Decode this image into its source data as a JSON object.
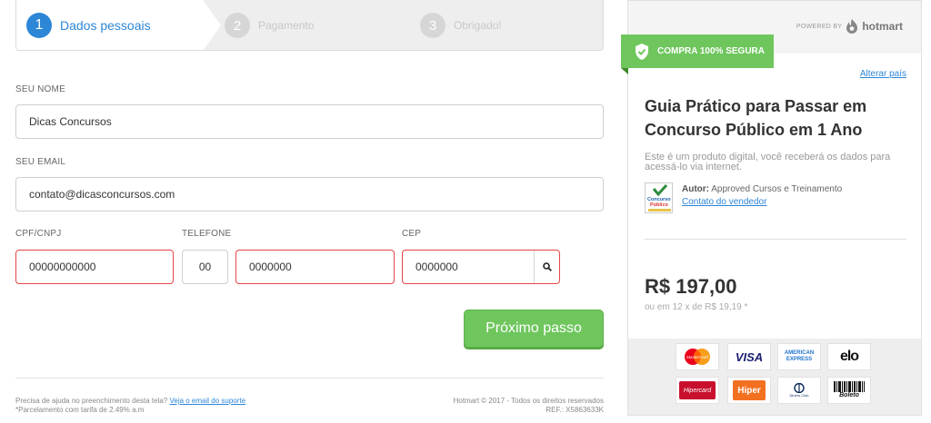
{
  "steps": [
    {
      "num": "1",
      "label": "Dados pessoais",
      "active": true
    },
    {
      "num": "2",
      "label": "Pagamento",
      "active": false
    },
    {
      "num": "3",
      "label": "Obrigado!",
      "active": false
    }
  ],
  "form": {
    "name_label": "SEU NOME",
    "name_value": "Dicas Concursos",
    "email_label": "SEU EMAIL",
    "email_value": "contato@dicasconcursos.com",
    "cpf_label": "CPF/CNPJ",
    "cpf_value": "00000000000",
    "phone_label": "TELEFONE",
    "ddd_value": "00",
    "phone_value": "0000000",
    "cep_label": "CEP",
    "cep_value": "0000000",
    "next_button": "Próximo passo"
  },
  "footer": {
    "help_text": "Precisa de ajuda no preenchimento desta tela?",
    "help_link": "Veja o email do suporte",
    "installment_note": "*Parcelamento com tarifa de 2.49% a.m",
    "copyright": "Hotmart © 2017 - Todos os direitos reservados",
    "ref": "REF.: X5863633K"
  },
  "panel": {
    "powered_by": "POWERED BY",
    "brand": "hotmart",
    "secure_badge": "COMPRA 100% SEGURA",
    "change_country": "Alterar país",
    "product_title": "Guia Prático para Passar em Concurso Público em 1 Ano",
    "product_desc": "Este é um produto digital, você receberá os dados para acessá-lo via internet.",
    "author_label": "Autor:",
    "author_name": "Approved Cursos e Treinamento",
    "contact_seller": "Contato do vendedor",
    "author_logo_text": [
      "Concurso",
      "Público"
    ],
    "price": "R$ 197,00",
    "installments": "ou em 12 x de R$ 19,19 *"
  },
  "payment_methods": [
    {
      "name": "mastercard",
      "label": "MasterCard"
    },
    {
      "name": "visa",
      "label": "VISA"
    },
    {
      "name": "american-express",
      "label": "AMERICAN EXPRESS"
    },
    {
      "name": "elo",
      "label": "elo"
    },
    {
      "name": "hipercard",
      "label": "Hipercard"
    },
    {
      "name": "hiper",
      "label": "Hiper"
    },
    {
      "name": "diners-club",
      "label": "Diners Club"
    },
    {
      "name": "boleto",
      "label": "Boleto"
    }
  ],
  "colors": {
    "accent_blue": "#2d86d6",
    "accent_green": "#6fc65d",
    "error_red": "#e64545"
  }
}
